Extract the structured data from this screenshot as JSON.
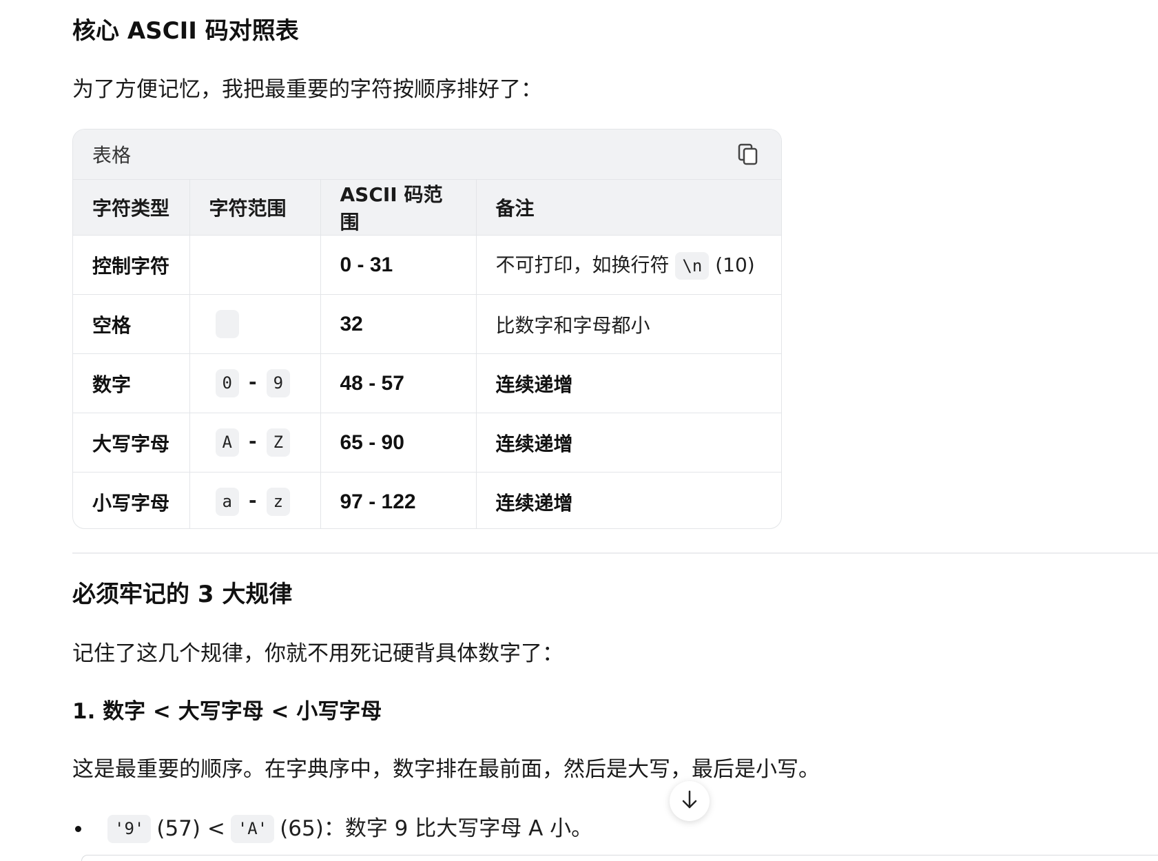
{
  "section1": {
    "heading": "核心 ASCII 码对照表",
    "intro": "为了方便记忆，我把最重要的字符按顺序排好了："
  },
  "table": {
    "card_title": "表格",
    "copy_icon": "copy-icon",
    "headers": [
      "字符类型",
      "字符范围",
      "ASCII 码范围",
      "备注"
    ],
    "rows": [
      {
        "type": "控制字符",
        "range_from": "",
        "range_to": "",
        "codes": "0 - 31",
        "note_prefix": "不可打印，如换行符",
        "note_code": "\\n",
        "note_suffix": "(10)"
      },
      {
        "type": "空格",
        "range_from": "",
        "range_to": "",
        "codes": "32",
        "note": "比数字和字母都小"
      },
      {
        "type": "数字",
        "range_from": "0",
        "range_to": "9",
        "codes": "48 - 57",
        "note": "连续递增"
      },
      {
        "type": "大写字母",
        "range_from": "A",
        "range_to": "Z",
        "codes": "65 - 90",
        "note": "连续递增"
      },
      {
        "type": "小写字母",
        "range_from": "a",
        "range_to": "z",
        "codes": "97 - 122",
        "note": "连续递增"
      }
    ],
    "dash": "-"
  },
  "section2": {
    "heading": "必须牢记的 3 大规律",
    "intro": "记住了这几个规律，你就不用死记硬背具体数字了：",
    "rule1_title": "1. 数字 < 大写字母 < 小写字母",
    "rule1_text": "这是最重要的顺序。在字典序中，数字排在最前面，然后是大写，最后是小写。",
    "bullet1": {
      "code_a": "'9'",
      "num_a": "(57) <",
      "code_b": "'A'",
      "text": "(65)：数字 9 比大写字母 A 小。"
    }
  },
  "scroll_icon": "arrow-down-icon"
}
